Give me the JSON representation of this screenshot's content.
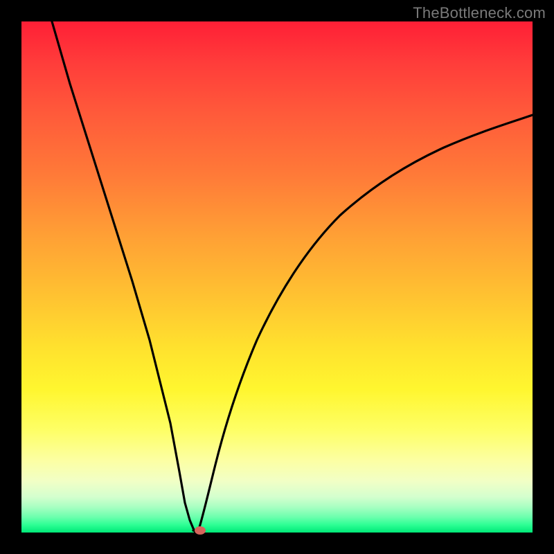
{
  "watermark": "TheBottleneck.com",
  "colors": {
    "frame": "#000000",
    "curve": "#000000",
    "marker": "#d6655c",
    "gradient_top": "#ff1f36",
    "gradient_bottom": "#00e877"
  },
  "chart_data": {
    "type": "line",
    "title": "",
    "xlabel": "",
    "ylabel": "",
    "xlim": [
      0,
      100
    ],
    "ylim": [
      0,
      100
    ],
    "grid": false,
    "legend": false,
    "series": [
      {
        "name": "left-branch",
        "x": [
          6,
          10,
          14,
          18,
          22,
          25,
          27,
          29,
          31,
          32,
          33,
          33.5,
          34
        ],
        "y": [
          100,
          88,
          75,
          62,
          49,
          38,
          30,
          22,
          12,
          6,
          2,
          0.5,
          0
        ]
      },
      {
        "name": "right-branch",
        "x": [
          34,
          35,
          37,
          40,
          44,
          49,
          55,
          62,
          70,
          79,
          89,
          100
        ],
        "y": [
          0,
          3,
          10,
          20,
          31,
          42,
          52,
          60,
          67,
          73,
          78,
          82
        ]
      }
    ],
    "annotations": [
      {
        "name": "min-marker",
        "x": 34.5,
        "y": 0
      }
    ]
  }
}
